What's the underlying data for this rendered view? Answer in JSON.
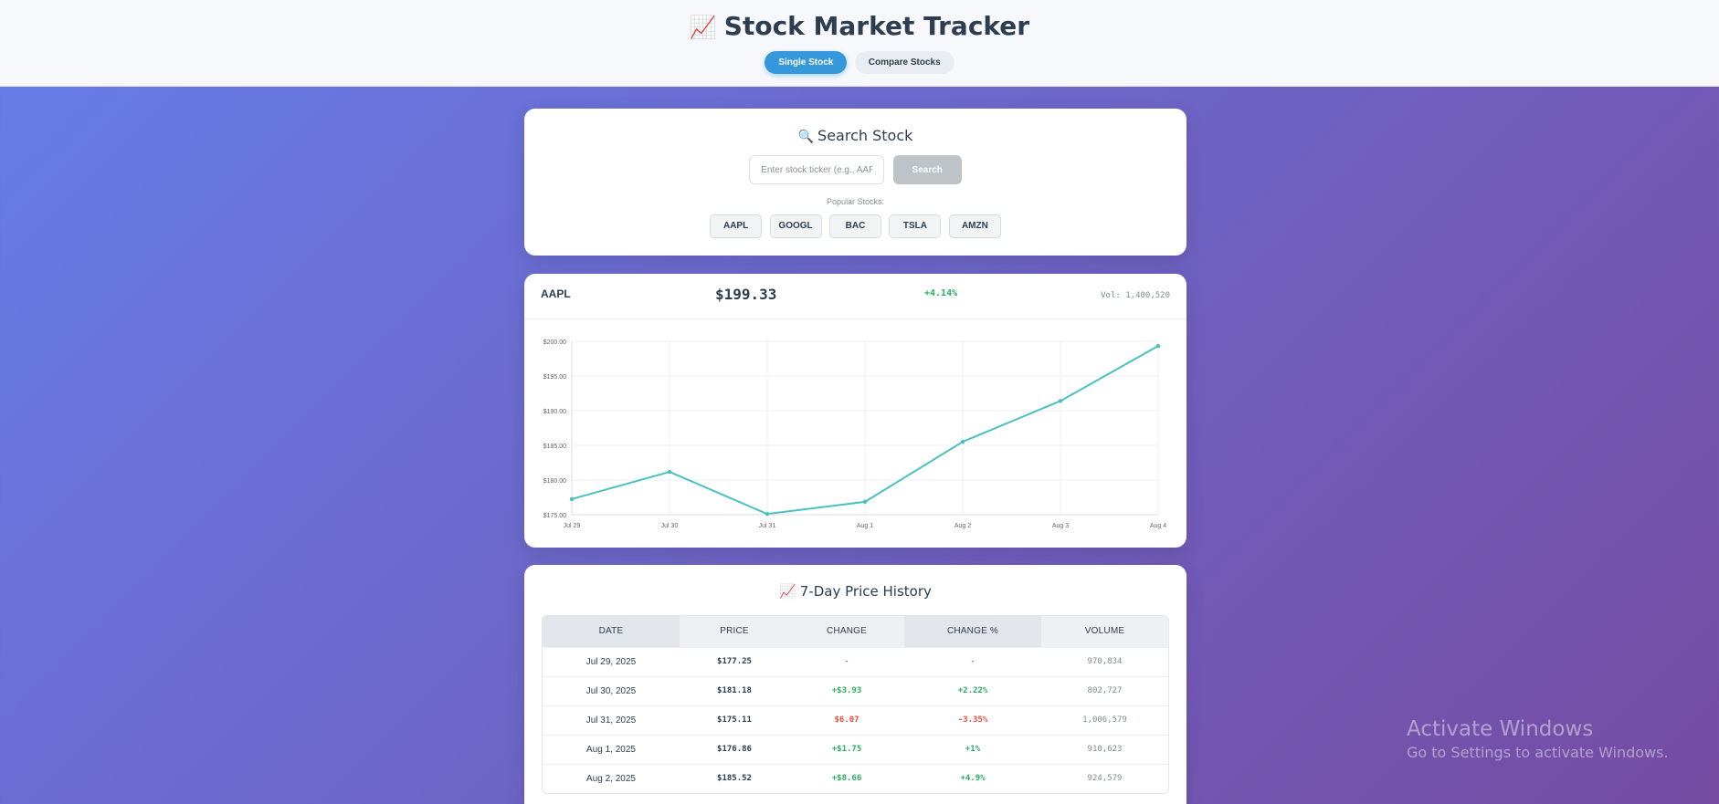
{
  "header": {
    "icon": "chart-increasing-icon",
    "title": "Stock Market Tracker",
    "tabs": [
      {
        "label": "Single Stock",
        "active": true
      },
      {
        "label": "Compare Stocks",
        "active": false
      }
    ]
  },
  "search": {
    "title": "Search Stock",
    "icon": "magnifier-icon",
    "placeholder": "Enter stock ticker (e.g., AAPL)",
    "value": "",
    "button": "Search",
    "popular_label": "Popular Stocks:",
    "popular": [
      "AAPL",
      "GOOGL",
      "BAC",
      "TSLA",
      "AMZN"
    ]
  },
  "quote": {
    "symbol": "AAPL",
    "price": "$199.33",
    "change": "+4.14%",
    "volume": "Vol: 1,400,520"
  },
  "chart_data": {
    "type": "line",
    "x": [
      "Jul 29",
      "Jul 30",
      "Jul 31",
      "Aug 1",
      "Aug 2",
      "Aug 3",
      "Aug 4"
    ],
    "values": [
      177.25,
      181.18,
      175.11,
      176.86,
      185.52,
      191.4,
      199.33
    ],
    "ylim": [
      175,
      200
    ],
    "yticks": [
      "$200.00",
      "$195.00",
      "$190.00",
      "$185.00",
      "$180.00",
      "$175.00"
    ],
    "grid": true,
    "color": "#4bc0c0"
  },
  "history": {
    "title": "7-Day Price History",
    "icon": "chart-increasing-icon",
    "columns": [
      "Date",
      "Price",
      "Change",
      "Change %",
      "Volume"
    ],
    "rows": [
      {
        "date": "Jul 29, 2025",
        "price": "$177.25",
        "change": "-",
        "change_pct": "-",
        "volume": "970,834",
        "dir": "none"
      },
      {
        "date": "Jul 30, 2025",
        "price": "$181.18",
        "change": "+$3.93",
        "change_pct": "+2.22%",
        "volume": "802,727",
        "dir": "pos"
      },
      {
        "date": "Jul 31, 2025",
        "price": "$175.11",
        "change": "$6.07",
        "change_pct": "-3.35%",
        "volume": "1,006,579",
        "dir": "neg"
      },
      {
        "date": "Aug 1, 2025",
        "price": "$176.86",
        "change": "+$1.75",
        "change_pct": "+1%",
        "volume": "910,623",
        "dir": "pos"
      },
      {
        "date": "Aug 2, 2025",
        "price": "$185.52",
        "change": "+$8.66",
        "change_pct": "+4.9%",
        "volume": "924,579",
        "dir": "pos"
      }
    ]
  },
  "watermark": {
    "title": "Activate Windows",
    "subtitle": "Go to Settings to activate Windows."
  },
  "colors": {
    "accent": "#3498db",
    "positive": "#27ae60",
    "negative": "#e74c3c",
    "line": "#4bc0c0"
  }
}
